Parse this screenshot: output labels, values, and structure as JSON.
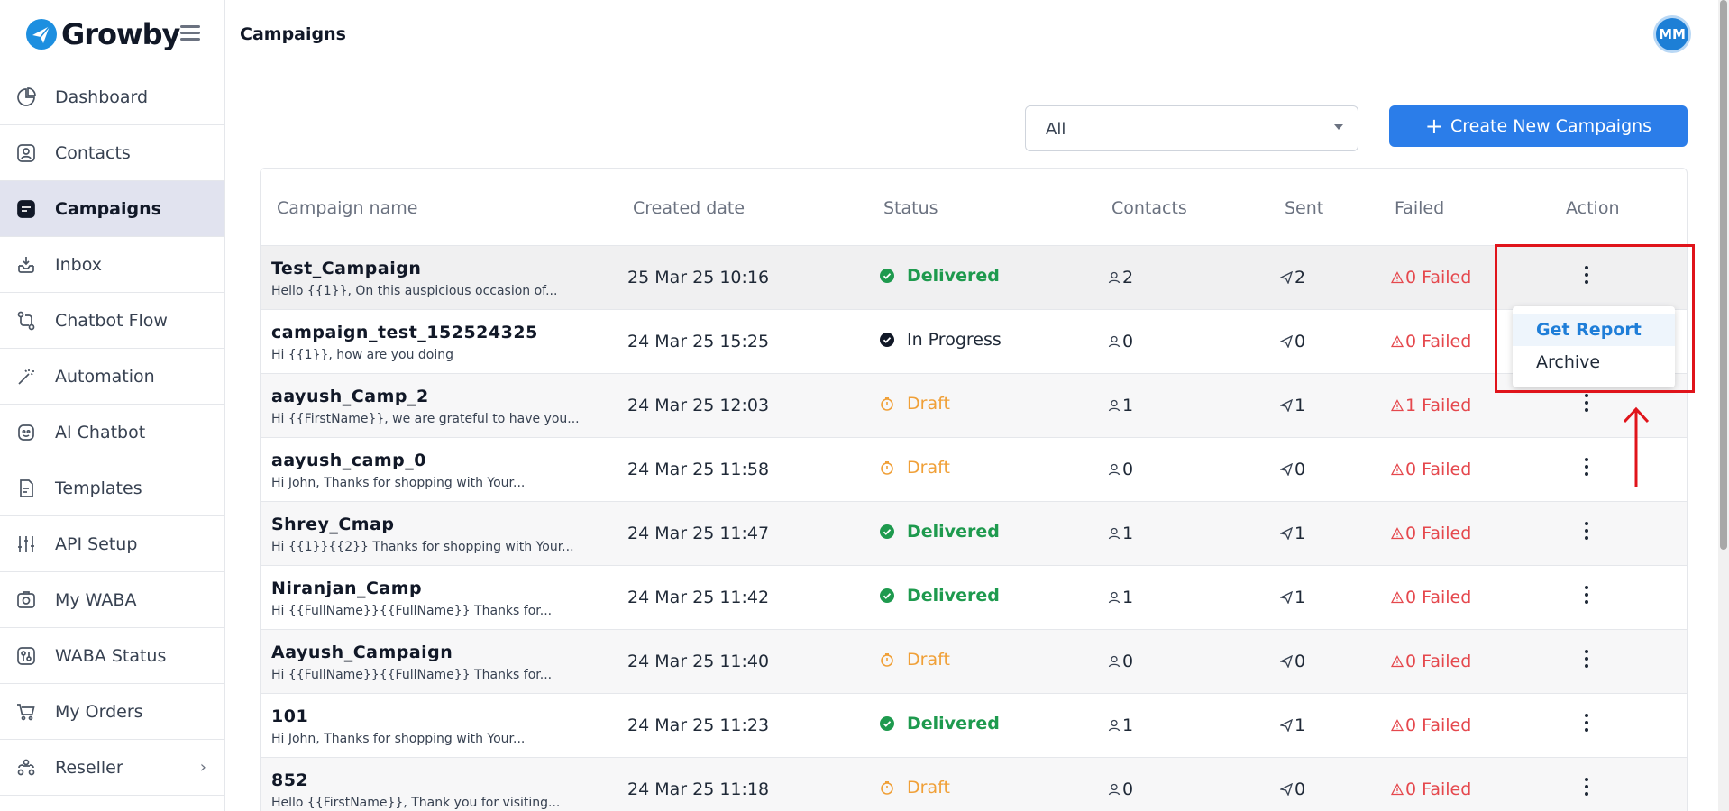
{
  "brand": {
    "name": "Growby"
  },
  "sidebar": {
    "items": [
      {
        "label": "Dashboard",
        "icon": "pie-chart-icon"
      },
      {
        "label": "Contacts",
        "icon": "contact-card-icon"
      },
      {
        "label": "Campaigns",
        "icon": "campaign-icon",
        "active": true
      },
      {
        "label": "Inbox",
        "icon": "inbox-icon"
      },
      {
        "label": "Chatbot Flow",
        "icon": "flow-icon"
      },
      {
        "label": "Automation",
        "icon": "magic-wand-icon"
      },
      {
        "label": "AI Chatbot",
        "icon": "robot-icon"
      },
      {
        "label": "Templates",
        "icon": "document-icon"
      },
      {
        "label": "API Setup",
        "icon": "sliders-icon"
      },
      {
        "label": "My WABA",
        "icon": "waba-icon"
      },
      {
        "label": "WABA Status",
        "icon": "status-icon"
      },
      {
        "label": "My Orders",
        "icon": "cart-icon"
      },
      {
        "label": "Reseller",
        "icon": "network-icon",
        "chevron": "›"
      }
    ]
  },
  "header": {
    "title": "Campaigns",
    "avatar_initials": "MM"
  },
  "toolbar": {
    "filter_value": "All",
    "create_label": "Create New Campaigns",
    "create_plus": "+"
  },
  "table": {
    "columns": [
      "Campaign name",
      "Created date",
      "Status",
      "Contacts",
      "Sent",
      "Failed",
      "Action"
    ],
    "rows": [
      {
        "name": "Test_Campaign",
        "message": "Hello {{1}}, On this auspicious occasion of...",
        "date": "25 Mar 25 10:16",
        "status": "Delivered",
        "contacts": "2",
        "sent": "2",
        "failed": "0 Failed"
      },
      {
        "name": "campaign_test_152524325",
        "message": "Hi {{1}}, how are you doing",
        "date": "24 Mar 25 15:25",
        "status": "In Progress",
        "contacts": "0",
        "sent": "0",
        "failed": "0 Failed"
      },
      {
        "name": "aayush_Camp_2",
        "message": "Hi {{FirstName}}, we are grateful to have you...",
        "date": "24 Mar 25 12:03",
        "status": "Draft",
        "contacts": "1",
        "sent": "1",
        "failed": "1 Failed"
      },
      {
        "name": "aayush_camp_0",
        "message": "Hi John, Thanks for shopping with Your...",
        "date": "24 Mar 25 11:58",
        "status": "Draft",
        "contacts": "0",
        "sent": "0",
        "failed": "0 Failed"
      },
      {
        "name": "Shrey_Cmap",
        "message": "Hi {{1}}{{2}} Thanks for shopping with Your...",
        "date": "24 Mar 25 11:47",
        "status": "Delivered",
        "contacts": "1",
        "sent": "1",
        "failed": "0 Failed"
      },
      {
        "name": "Niranjan_Camp",
        "message": "Hi {{FullName}}{{FullName}} Thanks for...",
        "date": "24 Mar 25 11:42",
        "status": "Delivered",
        "contacts": "1",
        "sent": "1",
        "failed": "0 Failed"
      },
      {
        "name": "Aayush_Campaign",
        "message": "Hi {{FullName}}{{FullName}} Thanks for...",
        "date": "24 Mar 25 11:40",
        "status": "Draft",
        "contacts": "0",
        "sent": "0",
        "failed": "0 Failed"
      },
      {
        "name": "101",
        "message": "Hi John, Thanks for shopping with Your...",
        "date": "24 Mar 25 11:23",
        "status": "Delivered",
        "contacts": "1",
        "sent": "1",
        "failed": "0 Failed"
      },
      {
        "name": "852",
        "message": "Hello {{FirstName}}, Thank you for visiting...",
        "date": "24 Mar 25 11:18",
        "status": "Draft",
        "contacts": "0",
        "sent": "0",
        "failed": "0 Failed"
      }
    ]
  },
  "action_menu": {
    "items": [
      "Get Report",
      "Archive"
    ]
  },
  "colors": {
    "accent": "#2b7de9",
    "delivered": "#1e9a4e",
    "draft": "#f0a038",
    "failed": "#e5484d",
    "annotation": "#e0141b"
  }
}
